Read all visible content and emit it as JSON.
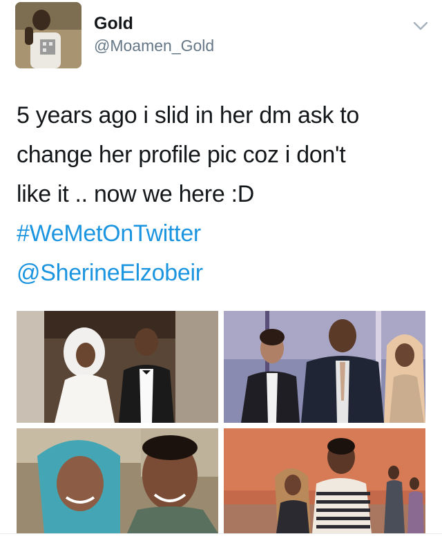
{
  "user": {
    "display_name": "Gold",
    "handle": "@Moamen_Gold",
    "avatar_icon": "profile-photo"
  },
  "menu": {
    "icon": "chevron-down-icon"
  },
  "tweet": {
    "lines": [
      "5 years ago i slid in her dm ask to",
      "change her profile pic coz i don't",
      "like it .. now we here :D"
    ],
    "hashtag": "#WeMetOnTwitter",
    "mention": "@SherineElzobeir"
  },
  "media": {
    "photos": [
      "wedding-couple-photo",
      "three-people-event-photo",
      "couple-selfie-photo",
      "couple-party-photo"
    ]
  },
  "colors": {
    "link": "#1b95e0",
    "text": "#14171a",
    "secondary": "#657786"
  }
}
